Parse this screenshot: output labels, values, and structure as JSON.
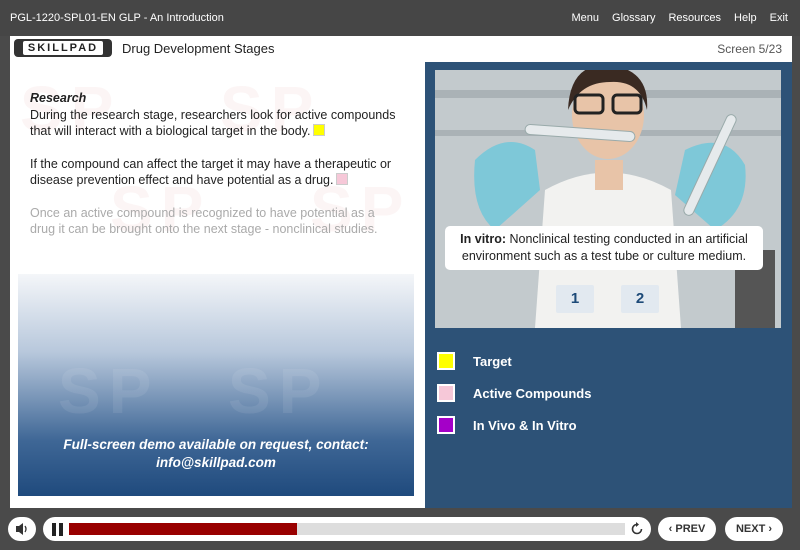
{
  "topbar": {
    "course_title": "PGL-1220-SPL01-EN GLP - An Introduction",
    "menu": [
      "Menu",
      "Glossary",
      "Resources",
      "Help",
      "Exit"
    ]
  },
  "header": {
    "logo_text": "SKILLPAD",
    "page_title": "Drug Development Stages",
    "screen_counter": "Screen 5/23"
  },
  "watermark_text": "SP",
  "content": {
    "heading": "Research",
    "para1": "During the research stage, researchers look for active compounds that will interact with a biological target in the body.",
    "para2": "If the compound can affect the target it may have a therapeutic or disease prevention effect and have potential as a drug.",
    "para3": "Once an active compound is recognized to have potential as a drug it can be brought onto the next stage - nonclinical studies.",
    "demo_line1": "Full-screen demo available on request, contact:",
    "demo_line2": "info@skillpad.com"
  },
  "image_panel": {
    "tooltip_term": "In vitro:",
    "tooltip_text": " Nonclinical testing conducted in an artificial environment such as a test tube or culture medium.",
    "hotspot1": "1",
    "hotspot2": "2"
  },
  "legend": [
    {
      "label": "Target",
      "color": "#ffff00"
    },
    {
      "label": "Active Compounds",
      "color": "#f6c8d8"
    },
    {
      "label": "In Vivo & In Vitro",
      "color": "#a400c8"
    }
  ],
  "colors": {
    "yellow": "#ffff00",
    "pink": "#f6c8d8",
    "progress_fill": "#990000",
    "panel_blue": "#2d5277"
  },
  "player": {
    "progress": 0.41,
    "prev_label": "‹ PREV",
    "next_label": "NEXT ›"
  }
}
